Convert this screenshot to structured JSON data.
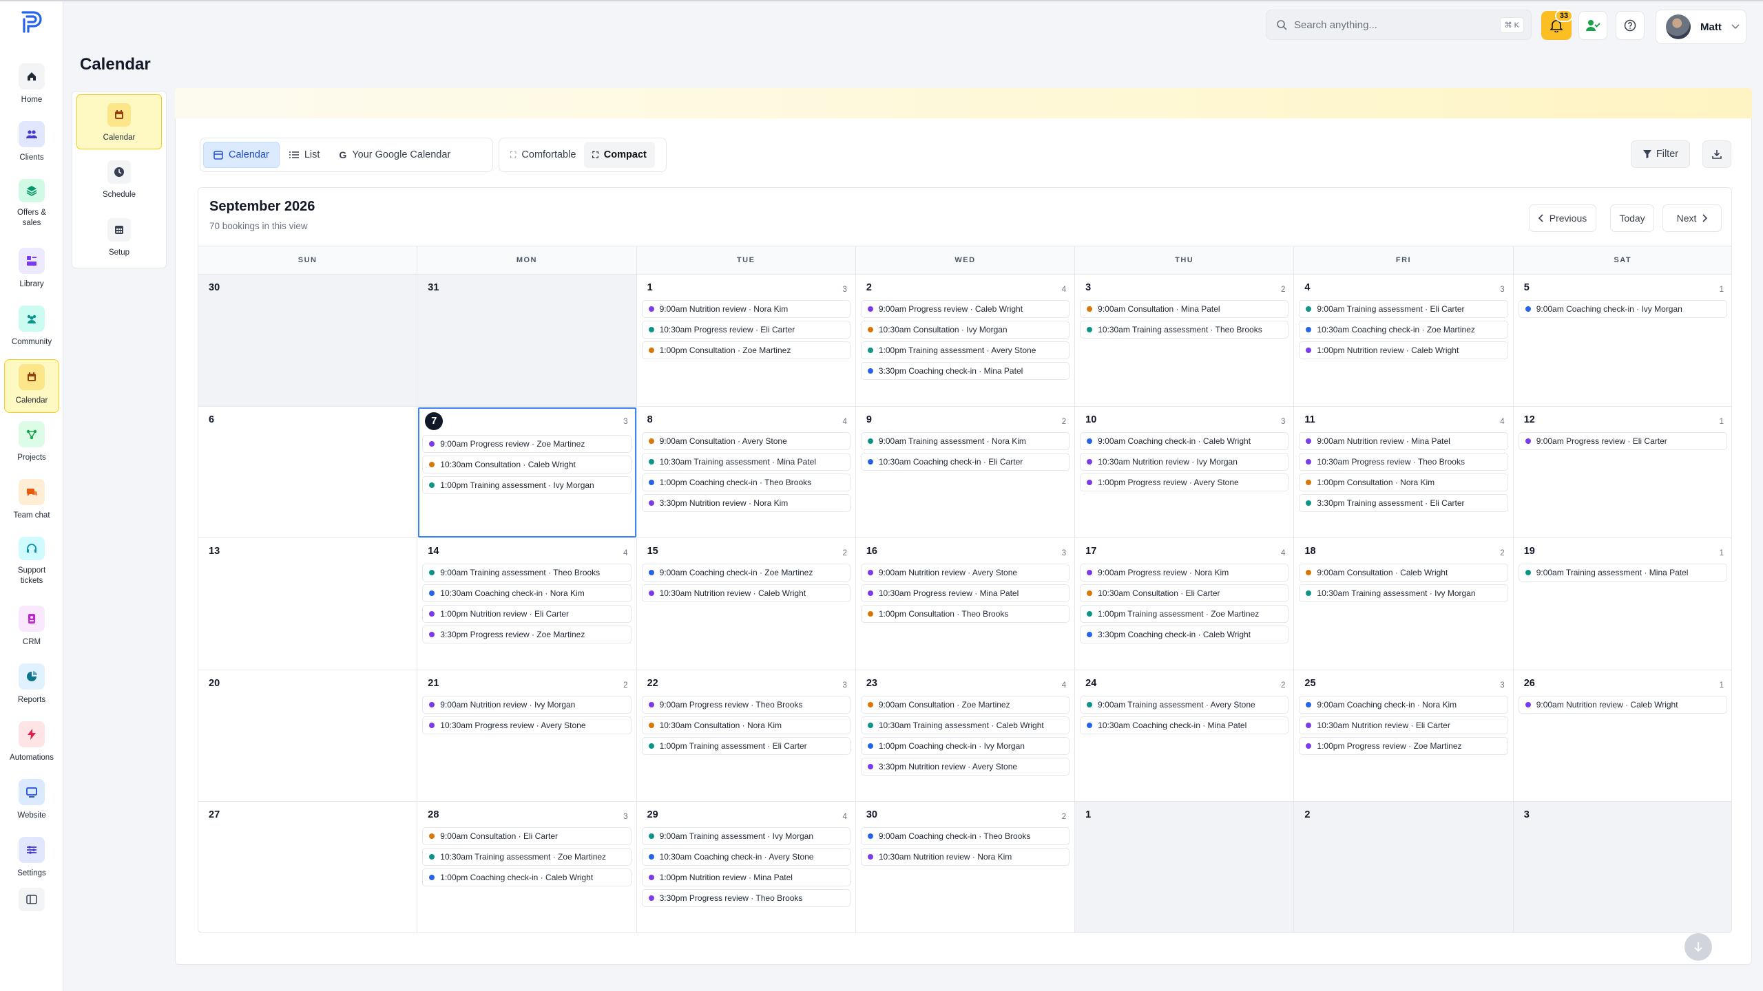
{
  "page": {
    "title": "Calendar"
  },
  "colors": {
    "accent_yellow": "#fbbf24",
    "active_bg": "#fef9c3",
    "primary_blue": "#1d4ed8"
  },
  "nav": {
    "items": [
      {
        "label": "Home",
        "icon": "home-icon",
        "color": "#1f2937",
        "bg": "#f3f4f6"
      },
      {
        "label": "Clients",
        "icon": "users-icon",
        "color": "#4338ca",
        "bg": "#e0e7ff"
      },
      {
        "label": "Offers & sales",
        "icon": "layers-icon",
        "color": "#059669",
        "bg": "#d1fae5"
      },
      {
        "label": "Library",
        "icon": "library-icon",
        "color": "#7c3aed",
        "bg": "#ede9fe"
      },
      {
        "label": "Community",
        "icon": "community-icon",
        "color": "#0d9488",
        "bg": "#ccfbf1"
      },
      {
        "label": "Calendar",
        "icon": "calendar-icon",
        "color": "#92400e",
        "bg": "#fde68a"
      },
      {
        "label": "Projects",
        "icon": "projects-icon",
        "color": "#16a34a",
        "bg": "#dcfce7"
      },
      {
        "label": "Team chat",
        "icon": "chat-icon",
        "color": "#ea580c",
        "bg": "#ffedd5"
      },
      {
        "label": "Support tickets",
        "icon": "headset-icon",
        "color": "#0891b2",
        "bg": "#cffafe"
      },
      {
        "label": "CRM",
        "icon": "crm-icon",
        "color": "#c026d3",
        "bg": "#fae8ff"
      },
      {
        "label": "Reports",
        "icon": "pie-chart-icon",
        "color": "#0e7490",
        "bg": "#e0f2fe"
      },
      {
        "label": "Automations",
        "icon": "bolt-icon",
        "color": "#e11d48",
        "bg": "#ffe4e6"
      },
      {
        "label": "Website",
        "icon": "monitor-icon",
        "color": "#1d4ed8",
        "bg": "#dbeafe"
      },
      {
        "label": "Settings",
        "icon": "sliders-icon",
        "color": "#4338ca",
        "bg": "#e0e7ff"
      }
    ]
  },
  "topbar": {
    "search_placeholder": "Search anything...",
    "search_shortcut": "⌘ K",
    "notification_count": "33",
    "user_name": "Matt"
  },
  "subnav": {
    "items": [
      "Calendar",
      "Schedule",
      "Setup"
    ]
  },
  "toolbar": {
    "view_tabs": [
      "Calendar",
      "List",
      "Your Google Calendar"
    ],
    "density": [
      "Comfortable",
      "Compact"
    ],
    "filter_label": "Filter"
  },
  "calendar": {
    "month_title": "September 2026",
    "booking_count": "70 bookings in this view",
    "prev_label": "Previous",
    "today_label": "Today",
    "next_label": "Next",
    "weekdays": [
      "SUN",
      "MON",
      "TUE",
      "WED",
      "THU",
      "FRI",
      "SAT"
    ],
    "days": [
      {
        "d": "30",
        "muted": true,
        "count": "",
        "events": []
      },
      {
        "d": "31",
        "muted": true,
        "count": "",
        "events": []
      },
      {
        "d": "1",
        "count": "3",
        "events": [
          [
            "9:00am Nutrition review · Nora Kim",
            "#7c3aed"
          ],
          [
            "10:30am Progress review · Eli Carter",
            "#0d9488"
          ],
          [
            "1:00pm Consultation · Zoe Martinez",
            "#d97706"
          ]
        ]
      },
      {
        "d": "2",
        "count": "4",
        "events": [
          [
            "9:00am Progress review · Caleb Wright",
            "#7c3aed"
          ],
          [
            "10:30am Consultation · Ivy Morgan",
            "#d97706"
          ],
          [
            "1:00pm Training assessment · Avery Stone",
            "#0d9488"
          ],
          [
            "3:30pm Coaching check-in · Mina Patel",
            "#2563eb"
          ]
        ]
      },
      {
        "d": "3",
        "count": "2",
        "events": [
          [
            "9:00am Consultation · Mina Patel",
            "#d97706"
          ],
          [
            "10:30am Training assessment · Theo Brooks",
            "#0d9488"
          ]
        ]
      },
      {
        "d": "4",
        "count": "3",
        "events": [
          [
            "9:00am Training assessment · Eli Carter",
            "#0d9488"
          ],
          [
            "10:30am Coaching check-in · Zoe Martinez",
            "#2563eb"
          ],
          [
            "1:00pm Nutrition review · Caleb Wright",
            "#7c3aed"
          ]
        ]
      },
      {
        "d": "5",
        "count": "1",
        "events": [
          [
            "9:00am Coaching check-in · Ivy Morgan",
            "#2563eb"
          ]
        ]
      },
      {
        "d": "6",
        "count": "",
        "events": []
      },
      {
        "d": "7",
        "today": true,
        "count": "3",
        "events": [
          [
            "9:00am Progress review · Zoe Martinez",
            "#7c3aed"
          ],
          [
            "10:30am Consultation · Caleb Wright",
            "#d97706"
          ],
          [
            "1:00pm Training assessment · Ivy Morgan",
            "#0d9488"
          ]
        ]
      },
      {
        "d": "8",
        "count": "4",
        "events": [
          [
            "9:00am Consultation · Avery Stone",
            "#d97706"
          ],
          [
            "10:30am Training assessment · Mina Patel",
            "#0d9488"
          ],
          [
            "1:00pm Coaching check-in · Theo Brooks",
            "#2563eb"
          ],
          [
            "3:30pm Nutrition review · Nora Kim",
            "#7c3aed"
          ]
        ]
      },
      {
        "d": "9",
        "count": "2",
        "events": [
          [
            "9:00am Training assessment · Nora Kim",
            "#0d9488"
          ],
          [
            "10:30am Coaching check-in · Eli Carter",
            "#2563eb"
          ]
        ]
      },
      {
        "d": "10",
        "count": "3",
        "events": [
          [
            "9:00am Coaching check-in · Caleb Wright",
            "#2563eb"
          ],
          [
            "10:30am Nutrition review · Ivy Morgan",
            "#7c3aed"
          ],
          [
            "1:00pm Progress review · Avery Stone",
            "#7c3aed"
          ]
        ]
      },
      {
        "d": "11",
        "count": "4",
        "events": [
          [
            "9:00am Nutrition review · Mina Patel",
            "#7c3aed"
          ],
          [
            "10:30am Progress review · Theo Brooks",
            "#7c3aed"
          ],
          [
            "1:00pm Consultation · Nora Kim",
            "#d97706"
          ],
          [
            "3:30pm Training assessment · Eli Carter",
            "#0d9488"
          ]
        ]
      },
      {
        "d": "12",
        "count": "1",
        "events": [
          [
            "9:00am Progress review · Eli Carter",
            "#7c3aed"
          ]
        ]
      },
      {
        "d": "13",
        "count": "",
        "events": []
      },
      {
        "d": "14",
        "count": "4",
        "events": [
          [
            "9:00am Training assessment · Theo Brooks",
            "#0d9488"
          ],
          [
            "10:30am Coaching check-in · Nora Kim",
            "#2563eb"
          ],
          [
            "1:00pm Nutrition review · Eli Carter",
            "#7c3aed"
          ],
          [
            "3:30pm Progress review · Zoe Martinez",
            "#7c3aed"
          ]
        ]
      },
      {
        "d": "15",
        "count": "2",
        "events": [
          [
            "9:00am Coaching check-in · Zoe Martinez",
            "#2563eb"
          ],
          [
            "10:30am Nutrition review · Caleb Wright",
            "#7c3aed"
          ]
        ]
      },
      {
        "d": "16",
        "count": "3",
        "events": [
          [
            "9:00am Nutrition review · Avery Stone",
            "#7c3aed"
          ],
          [
            "10:30am Progress review · Mina Patel",
            "#7c3aed"
          ],
          [
            "1:00pm Consultation · Theo Brooks",
            "#d97706"
          ]
        ]
      },
      {
        "d": "17",
        "count": "4",
        "events": [
          [
            "9:00am Progress review · Nora Kim",
            "#7c3aed"
          ],
          [
            "10:30am Consultation · Eli Carter",
            "#d97706"
          ],
          [
            "1:00pm Training assessment · Zoe Martinez",
            "#0d9488"
          ],
          [
            "3:30pm Coaching check-in · Caleb Wright",
            "#2563eb"
          ]
        ]
      },
      {
        "d": "18",
        "count": "2",
        "events": [
          [
            "9:00am Consultation · Caleb Wright",
            "#d97706"
          ],
          [
            "10:30am Training assessment · Ivy Morgan",
            "#0d9488"
          ]
        ]
      },
      {
        "d": "19",
        "count": "1",
        "events": [
          [
            "9:00am Training assessment · Mina Patel",
            "#0d9488"
          ]
        ]
      },
      {
        "d": "20",
        "count": "",
        "events": []
      },
      {
        "d": "21",
        "count": "2",
        "events": [
          [
            "9:00am Nutrition review · Ivy Morgan",
            "#7c3aed"
          ],
          [
            "10:30am Progress review · Avery Stone",
            "#7c3aed"
          ]
        ]
      },
      {
        "d": "22",
        "count": "3",
        "events": [
          [
            "9:00am Progress review · Theo Brooks",
            "#7c3aed"
          ],
          [
            "10:30am Consultation · Nora Kim",
            "#d97706"
          ],
          [
            "1:00pm Training assessment · Eli Carter",
            "#0d9488"
          ]
        ]
      },
      {
        "d": "23",
        "count": "4",
        "events": [
          [
            "9:00am Consultation · Zoe Martinez",
            "#d97706"
          ],
          [
            "10:30am Training assessment · Caleb Wright",
            "#0d9488"
          ],
          [
            "1:00pm Coaching check-in · Ivy Morgan",
            "#2563eb"
          ],
          [
            "3:30pm Nutrition review · Avery Stone",
            "#7c3aed"
          ]
        ]
      },
      {
        "d": "24",
        "count": "2",
        "events": [
          [
            "9:00am Training assessment · Avery Stone",
            "#0d9488"
          ],
          [
            "10:30am Coaching check-in · Mina Patel",
            "#2563eb"
          ]
        ]
      },
      {
        "d": "25",
        "count": "3",
        "events": [
          [
            "9:00am Coaching check-in · Nora Kim",
            "#2563eb"
          ],
          [
            "10:30am Nutrition review · Eli Carter",
            "#7c3aed"
          ],
          [
            "1:00pm Progress review · Zoe Martinez",
            "#7c3aed"
          ]
        ]
      },
      {
        "d": "26",
        "count": "1",
        "events": [
          [
            "9:00am Nutrition review · Caleb Wright",
            "#7c3aed"
          ]
        ]
      },
      {
        "d": "27",
        "count": "",
        "events": []
      },
      {
        "d": "28",
        "count": "3",
        "events": [
          [
            "9:00am Consultation · Eli Carter",
            "#d97706"
          ],
          [
            "10:30am Training assessment · Zoe Martinez",
            "#0d9488"
          ],
          [
            "1:00pm Coaching check-in · Caleb Wright",
            "#2563eb"
          ]
        ]
      },
      {
        "d": "29",
        "count": "4",
        "events": [
          [
            "9:00am Training assessment · Ivy Morgan",
            "#0d9488"
          ],
          [
            "10:30am Coaching check-in · Avery Stone",
            "#2563eb"
          ],
          [
            "1:00pm Nutrition review · Mina Patel",
            "#7c3aed"
          ],
          [
            "3:30pm Progress review · Theo Brooks",
            "#7c3aed"
          ]
        ]
      },
      {
        "d": "30",
        "count": "2",
        "events": [
          [
            "9:00am Coaching check-in · Theo Brooks",
            "#2563eb"
          ],
          [
            "10:30am Nutrition review · Nora Kim",
            "#7c3aed"
          ]
        ]
      },
      {
        "d": "1",
        "muted": true,
        "count": "",
        "events": []
      },
      {
        "d": "2",
        "muted": true,
        "count": "",
        "events": []
      },
      {
        "d": "3",
        "muted": true,
        "count": "",
        "events": []
      }
    ]
  }
}
